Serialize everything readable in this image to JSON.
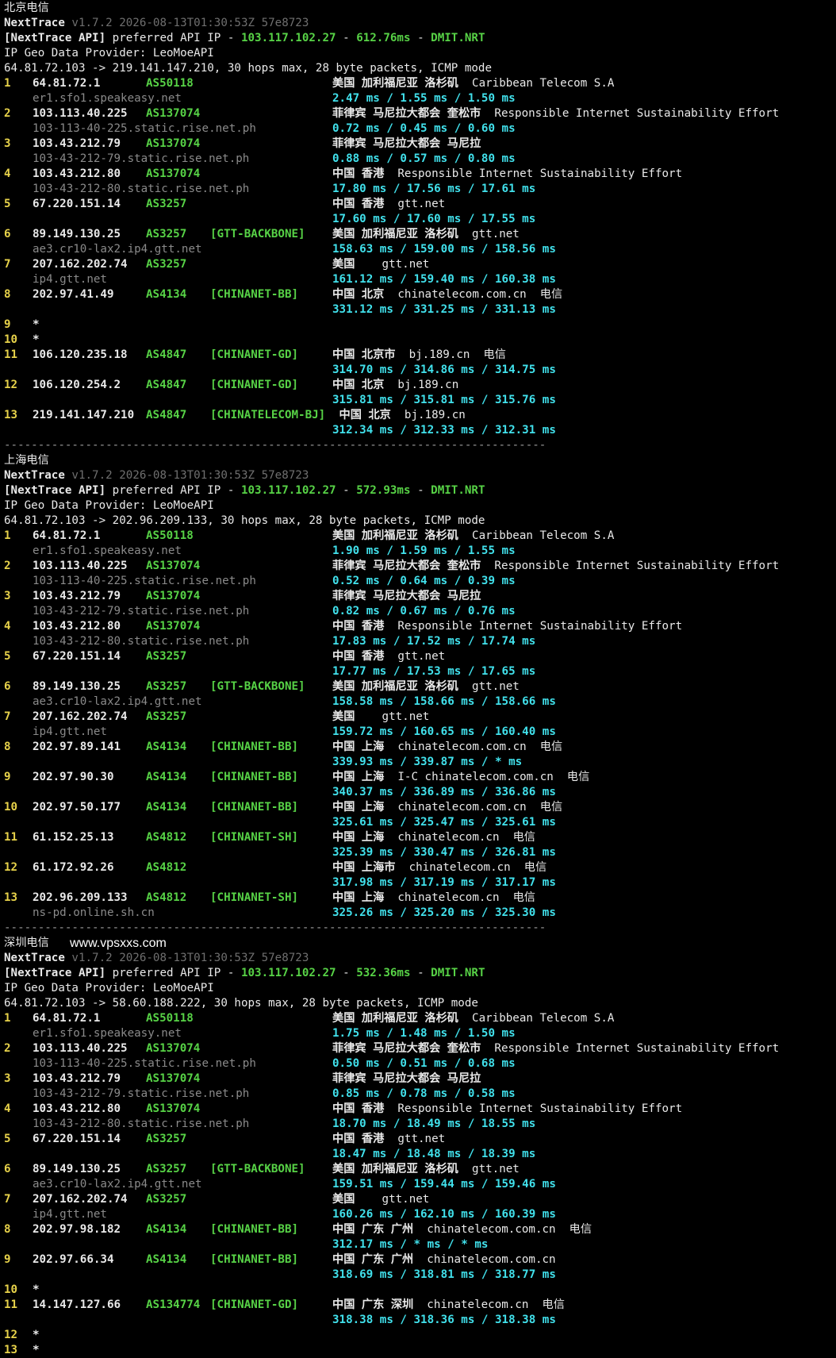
{
  "watermark": "www.vpsxxs.com",
  "sections": [
    {
      "label": "北京电信",
      "version": {
        "name": "NextTrace",
        "rest": " v1.7.2 2026-08-13T01:30:53Z 57e8723"
      },
      "api": {
        "prefix": "[NextTrace API]",
        "mid": " preferred API IP - ",
        "ip": "103.117.102.27",
        "dash1": " - ",
        "ms": "612.76ms",
        "dash2": " - ",
        "node": "DMIT.NRT"
      },
      "provider": "IP Geo Data Provider: LeoMoeAPI",
      "route": "64.81.72.103 -> 219.141.147.210, 30 hops max, 28 byte packets, ICMP mode",
      "hops": [
        {
          "no": "1",
          "ip": "64.81.72.1",
          "asn": "AS50118",
          "tag": "",
          "geo": "美国 加利福尼亚 洛杉矶",
          "org": "  Caribbean Telecom S.A",
          "host": "er1.sfo1.speakeasy.net",
          "rtt": "2.47 ms / 1.55 ms / 1.50 ms"
        },
        {
          "no": "2",
          "ip": "103.113.40.225",
          "asn": "AS137074",
          "tag": "",
          "geo": "菲律宾 马尼拉大都会 奎松市",
          "org": "  Responsible Internet Sustainability Effort",
          "host": "103-113-40-225.static.rise.net.ph",
          "rtt": "0.72 ms / 0.45 ms / 0.60 ms"
        },
        {
          "no": "3",
          "ip": "103.43.212.79",
          "asn": "AS137074",
          "tag": "",
          "geo": "菲律宾 马尼拉大都会 马尼拉",
          "org": "",
          "host": "103-43-212-79.static.rise.net.ph",
          "rtt": "0.88 ms / 0.57 ms / 0.80 ms"
        },
        {
          "no": "4",
          "ip": "103.43.212.80",
          "asn": "AS137074",
          "tag": "",
          "geo": "中国 香港",
          "org": "  Responsible Internet Sustainability Effort",
          "host": "103-43-212-80.static.rise.net.ph",
          "rtt": "17.80 ms / 17.56 ms / 17.61 ms"
        },
        {
          "no": "5",
          "ip": "67.220.151.14",
          "asn": "AS3257",
          "tag": "",
          "geo": "中国 香港",
          "org": "  gtt.net",
          "host": "",
          "rtt": "17.60 ms / 17.60 ms / 17.55 ms"
        },
        {
          "no": "6",
          "ip": "89.149.130.25",
          "asn": "AS3257",
          "tag": "[GTT-BACKBONE]",
          "geo": "美国 加利福尼亚 洛杉矶",
          "org": "  gtt.net",
          "host": "ae3.cr10-lax2.ip4.gtt.net",
          "rtt": "158.63 ms / 159.00 ms / 158.56 ms"
        },
        {
          "no": "7",
          "ip": "207.162.202.74",
          "asn": "AS3257",
          "tag": "",
          "geo": "美国",
          "org": "    gtt.net",
          "host": "ip4.gtt.net",
          "rtt": "161.12 ms / 159.40 ms / 160.38 ms"
        },
        {
          "no": "8",
          "ip": "202.97.41.49",
          "asn": "AS4134",
          "tag": "[CHINANET-BB]",
          "geo": "中国 北京",
          "org": "  chinatelecom.com.cn  电信",
          "host": "",
          "rtt": "331.12 ms / 331.25 ms / 331.13 ms"
        },
        {
          "no": "9",
          "ip": "*",
          "asn": "",
          "tag": "",
          "geo": "",
          "org": "",
          "host": "",
          "rtt": ""
        },
        {
          "no": "10",
          "ip": "*",
          "asn": "",
          "tag": "",
          "geo": "",
          "org": "",
          "host": "",
          "rtt": ""
        },
        {
          "no": "11",
          "ip": "106.120.235.18",
          "asn": "AS4847",
          "tag": "[CHINANET-GD]",
          "geo": "中国 北京市",
          "org": "  bj.189.cn  电信",
          "host": "",
          "rtt": "314.70 ms / 314.86 ms / 314.75 ms"
        },
        {
          "no": "12",
          "ip": "106.120.254.2",
          "asn": "AS4847",
          "tag": "[CHINANET-GD]",
          "geo": "中国 北京",
          "org": "  bj.189.cn",
          "host": "",
          "rtt": "315.81 ms / 315.81 ms / 315.76 ms"
        },
        {
          "no": "13",
          "ip": "219.141.147.210",
          "asn": "AS4847",
          "tag": "[CHINATELECOM-BJ]",
          "geo": " 中国 北京",
          "org": "  bj.189.cn",
          "host": "",
          "rtt": "312.34 ms / 312.33 ms / 312.31 ms"
        }
      ]
    },
    {
      "label": "上海电信",
      "version": {
        "name": "NextTrace",
        "rest": " v1.7.2 2026-08-13T01:30:53Z 57e8723"
      },
      "api": {
        "prefix": "[NextTrace API]",
        "mid": " preferred API IP - ",
        "ip": "103.117.102.27",
        "dash1": " - ",
        "ms": "572.93ms",
        "dash2": " - ",
        "node": "DMIT.NRT"
      },
      "provider": "IP Geo Data Provider: LeoMoeAPI",
      "route": "64.81.72.103 -> 202.96.209.133, 30 hops max, 28 byte packets, ICMP mode",
      "hops": [
        {
          "no": "1",
          "ip": "64.81.72.1",
          "asn": "AS50118",
          "tag": "",
          "geo": "美国 加利福尼亚 洛杉矶",
          "org": "  Caribbean Telecom S.A",
          "host": "er1.sfo1.speakeasy.net",
          "rtt": "1.90 ms / 1.59 ms / 1.55 ms"
        },
        {
          "no": "2",
          "ip": "103.113.40.225",
          "asn": "AS137074",
          "tag": "",
          "geo": "菲律宾 马尼拉大都会 奎松市",
          "org": "  Responsible Internet Sustainability Effort",
          "host": "103-113-40-225.static.rise.net.ph",
          "rtt": "0.52 ms / 0.64 ms / 0.39 ms"
        },
        {
          "no": "3",
          "ip": "103.43.212.79",
          "asn": "AS137074",
          "tag": "",
          "geo": "菲律宾 马尼拉大都会 马尼拉",
          "org": "",
          "host": "103-43-212-79.static.rise.net.ph",
          "rtt": "0.82 ms / 0.67 ms / 0.76 ms"
        },
        {
          "no": "4",
          "ip": "103.43.212.80",
          "asn": "AS137074",
          "tag": "",
          "geo": "中国 香港",
          "org": "  Responsible Internet Sustainability Effort",
          "host": "103-43-212-80.static.rise.net.ph",
          "rtt": "17.83 ms / 17.52 ms / 17.74 ms"
        },
        {
          "no": "5",
          "ip": "67.220.151.14",
          "asn": "AS3257",
          "tag": "",
          "geo": "中国 香港",
          "org": "  gtt.net",
          "host": "",
          "rtt": "17.77 ms / 17.53 ms / 17.65 ms"
        },
        {
          "no": "6",
          "ip": "89.149.130.25",
          "asn": "AS3257",
          "tag": "[GTT-BACKBONE]",
          "geo": "美国 加利福尼亚 洛杉矶",
          "org": "  gtt.net",
          "host": "ae3.cr10-lax2.ip4.gtt.net",
          "rtt": "158.58 ms / 158.66 ms / 158.66 ms"
        },
        {
          "no": "7",
          "ip": "207.162.202.74",
          "asn": "AS3257",
          "tag": "",
          "geo": "美国",
          "org": "    gtt.net",
          "host": "ip4.gtt.net",
          "rtt": "159.72 ms / 160.65 ms / 160.40 ms"
        },
        {
          "no": "8",
          "ip": "202.97.89.141",
          "asn": "AS4134",
          "tag": "[CHINANET-BB]",
          "geo": "中国 上海",
          "org": "  chinatelecom.com.cn  电信",
          "host": "",
          "rtt": "339.93 ms / 339.87 ms / * ms"
        },
        {
          "no": "9",
          "ip": "202.97.90.30",
          "asn": "AS4134",
          "tag": "[CHINANET-BB]",
          "geo": "中国 上海",
          "org": "  I-C chinatelecom.com.cn  电信",
          "host": "",
          "rtt": "340.37 ms / 336.89 ms / 336.86 ms"
        },
        {
          "no": "10",
          "ip": "202.97.50.177",
          "asn": "AS4134",
          "tag": "[CHINANET-BB]",
          "geo": "中国 上海",
          "org": "  chinatelecom.com.cn  电信",
          "host": "",
          "rtt": "325.61 ms / 325.47 ms / 325.61 ms"
        },
        {
          "no": "11",
          "ip": "61.152.25.13",
          "asn": "AS4812",
          "tag": "[CHINANET-SH]",
          "geo": "中国 上海",
          "org": "  chinatelecom.cn  电信",
          "host": "",
          "rtt": "325.39 ms / 330.47 ms / 326.81 ms"
        },
        {
          "no": "12",
          "ip": "61.172.92.26",
          "asn": "AS4812",
          "tag": "",
          "geo": "中国 上海市",
          "org": "  chinatelecom.cn  电信",
          "host": "",
          "rtt": "317.98 ms / 317.19 ms / 317.17 ms"
        },
        {
          "no": "13",
          "ip": "202.96.209.133",
          "asn": "AS4812",
          "tag": "[CHINANET-SH]",
          "geo": "中国 上海",
          "org": "  chinatelecom.cn  电信",
          "host": "ns-pd.online.sh.cn",
          "rtt": "325.26 ms / 325.20 ms / 325.30 ms"
        }
      ]
    },
    {
      "label": "深圳电信",
      "version": {
        "name": "NextTrace",
        "rest": " v1.7.2 2026-08-13T01:30:53Z 57e8723"
      },
      "api": {
        "prefix": "[NextTrace API]",
        "mid": " preferred API IP - ",
        "ip": "103.117.102.27",
        "dash1": " - ",
        "ms": "532.36ms",
        "dash2": " - ",
        "node": "DMIT.NRT"
      },
      "provider": "IP Geo Data Provider: LeoMoeAPI",
      "route": "64.81.72.103 -> 58.60.188.222, 30 hops max, 28 byte packets, ICMP mode",
      "hops": [
        {
          "no": "1",
          "ip": "64.81.72.1",
          "asn": "AS50118",
          "tag": "",
          "geo": "美国 加利福尼亚 洛杉矶",
          "org": "  Caribbean Telecom S.A",
          "host": "er1.sfo1.speakeasy.net",
          "rtt": "1.75 ms / 1.48 ms / 1.50 ms"
        },
        {
          "no": "2",
          "ip": "103.113.40.225",
          "asn": "AS137074",
          "tag": "",
          "geo": "菲律宾 马尼拉大都会 奎松市",
          "org": "  Responsible Internet Sustainability Effort",
          "host": "103-113-40-225.static.rise.net.ph",
          "rtt": "0.50 ms / 0.51 ms / 0.68 ms"
        },
        {
          "no": "3",
          "ip": "103.43.212.79",
          "asn": "AS137074",
          "tag": "",
          "geo": "菲律宾 马尼拉大都会 马尼拉",
          "org": "",
          "host": "103-43-212-79.static.rise.net.ph",
          "rtt": "0.85 ms / 0.78 ms / 0.58 ms"
        },
        {
          "no": "4",
          "ip": "103.43.212.80",
          "asn": "AS137074",
          "tag": "",
          "geo": "中国 香港",
          "org": "  Responsible Internet Sustainability Effort",
          "host": "103-43-212-80.static.rise.net.ph",
          "rtt": "18.70 ms / 18.49 ms / 18.55 ms"
        },
        {
          "no": "5",
          "ip": "67.220.151.14",
          "asn": "AS3257",
          "tag": "",
          "geo": "中国 香港",
          "org": "  gtt.net",
          "host": "",
          "rtt": "18.47 ms / 18.48 ms / 18.39 ms"
        },
        {
          "no": "6",
          "ip": "89.149.130.25",
          "asn": "AS3257",
          "tag": "[GTT-BACKBONE]",
          "geo": "美国 加利福尼亚 洛杉矶",
          "org": "  gtt.net",
          "host": "ae3.cr10-lax2.ip4.gtt.net",
          "rtt": "159.51 ms / 159.44 ms / 159.46 ms"
        },
        {
          "no": "7",
          "ip": "207.162.202.74",
          "asn": "AS3257",
          "tag": "",
          "geo": "美国",
          "org": "    gtt.net",
          "host": "ip4.gtt.net",
          "rtt": "160.26 ms / 162.10 ms / 160.39 ms"
        },
        {
          "no": "8",
          "ip": "202.97.98.182",
          "asn": "AS4134",
          "tag": "[CHINANET-BB]",
          "geo": "中国 广东 广州",
          "org": "  chinatelecom.com.cn  电信",
          "host": "",
          "rtt": "312.17 ms / * ms / * ms"
        },
        {
          "no": "9",
          "ip": "202.97.66.34",
          "asn": "AS4134",
          "tag": "[CHINANET-BB]",
          "geo": "中国 广东 广州",
          "org": "  chinatelecom.com.cn",
          "host": "",
          "rtt": "318.69 ms / 318.81 ms / 318.77 ms"
        },
        {
          "no": "10",
          "ip": "*",
          "asn": "",
          "tag": "",
          "geo": "",
          "org": "",
          "host": "",
          "rtt": ""
        },
        {
          "no": "11",
          "ip": "14.147.127.66",
          "asn": "AS134774",
          "tag": "[CHINANET-GD]",
          "geo": "中国 广东 深圳",
          "org": "  chinatelecom.cn  电信",
          "host": "",
          "rtt": "318.38 ms / 318.36 ms / 318.38 ms"
        },
        {
          "no": "12",
          "ip": "*",
          "asn": "",
          "tag": "",
          "geo": "",
          "org": "",
          "host": "",
          "rtt": ""
        },
        {
          "no": "13",
          "ip": "*",
          "asn": "",
          "tag": "",
          "geo": "",
          "org": "",
          "host": "",
          "rtt": ""
        }
      ]
    }
  ],
  "separator": "--------------------------------------------------------------------------------"
}
